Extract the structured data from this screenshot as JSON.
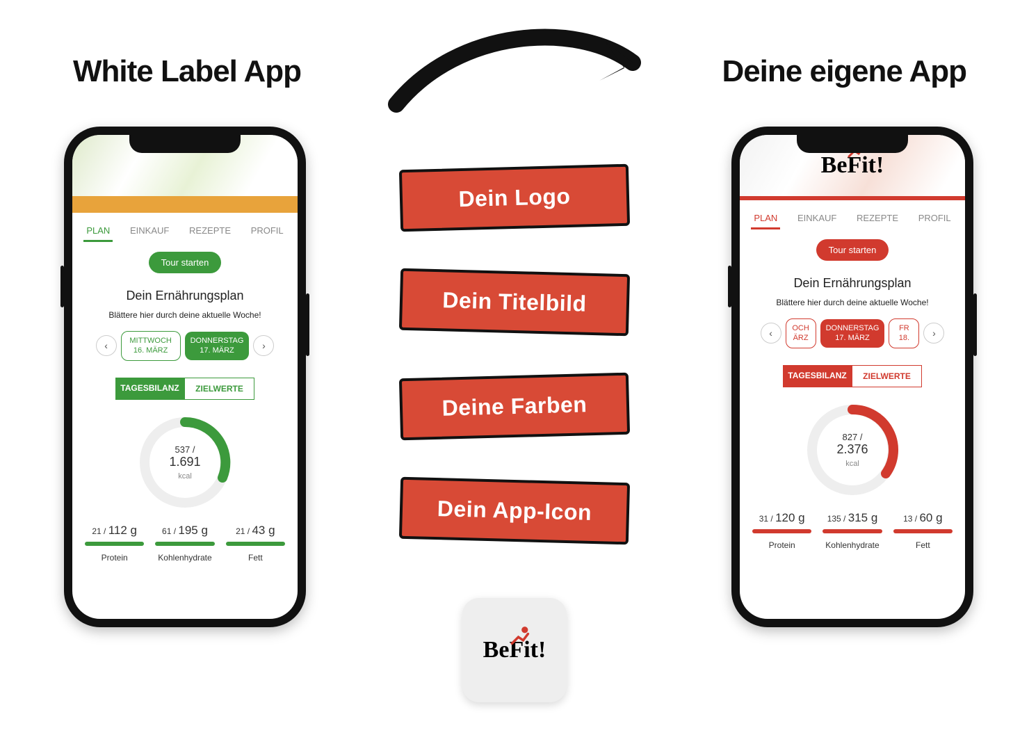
{
  "headings": {
    "left": "White Label App",
    "right": "Deine eigene App"
  },
  "badges": {
    "b1": "Dein Logo",
    "b2": "Dein Titelbild",
    "b3": "Deine Farben",
    "b4": "Dein App-Icon"
  },
  "app_icon": {
    "brand": "BeFit!"
  },
  "phone_common": {
    "tabs": {
      "plan": "PLAN",
      "einkauf": "EINKAUF",
      "rezepte": "REZEPTE",
      "profil": "PROFIL"
    },
    "tour_btn": "Tour starten",
    "section_title": "Dein Ernährungsplan",
    "section_sub": "Blättere hier durch deine aktuelle Woche!",
    "seg": {
      "a": "TAGESBILANZ",
      "b": "ZIELWERTE"
    },
    "gauge_unit": "kcal",
    "macros_labels": {
      "protein": "Protein",
      "carbs": "Kohlenhydrate",
      "fat": "Fett"
    }
  },
  "phone_left": {
    "accent": "#3c9a3c",
    "days": {
      "prev": {
        "name": "MITTWOCH",
        "date": "16. MÄRZ"
      },
      "curr": {
        "name": "DONNERSTAG",
        "date": "17. MÄRZ"
      }
    },
    "gauge": {
      "current": "537 /",
      "target": "1.691"
    },
    "macros": {
      "protein": {
        "cur": "21 /",
        "tot": "112 g"
      },
      "carbs": {
        "cur": "61 /",
        "tot": "195 g"
      },
      "fat": {
        "cur": "21 /",
        "tot": "43 g"
      }
    }
  },
  "phone_right": {
    "accent": "#d13a2e",
    "hero_brand": "BeFit!",
    "days": {
      "prev": {
        "name": "OCH",
        "date": "ÄRZ"
      },
      "curr": {
        "name": "DONNERSTAG",
        "date": "17. MÄRZ"
      },
      "next": {
        "name": "FR",
        "date": "18."
      }
    },
    "gauge": {
      "current": "827 /",
      "target": "2.376"
    },
    "macros": {
      "protein": {
        "cur": "31 /",
        "tot": "120 g"
      },
      "carbs": {
        "cur": "135 /",
        "tot": "315 g"
      },
      "fat": {
        "cur": "13 /",
        "tot": "60 g"
      }
    }
  }
}
